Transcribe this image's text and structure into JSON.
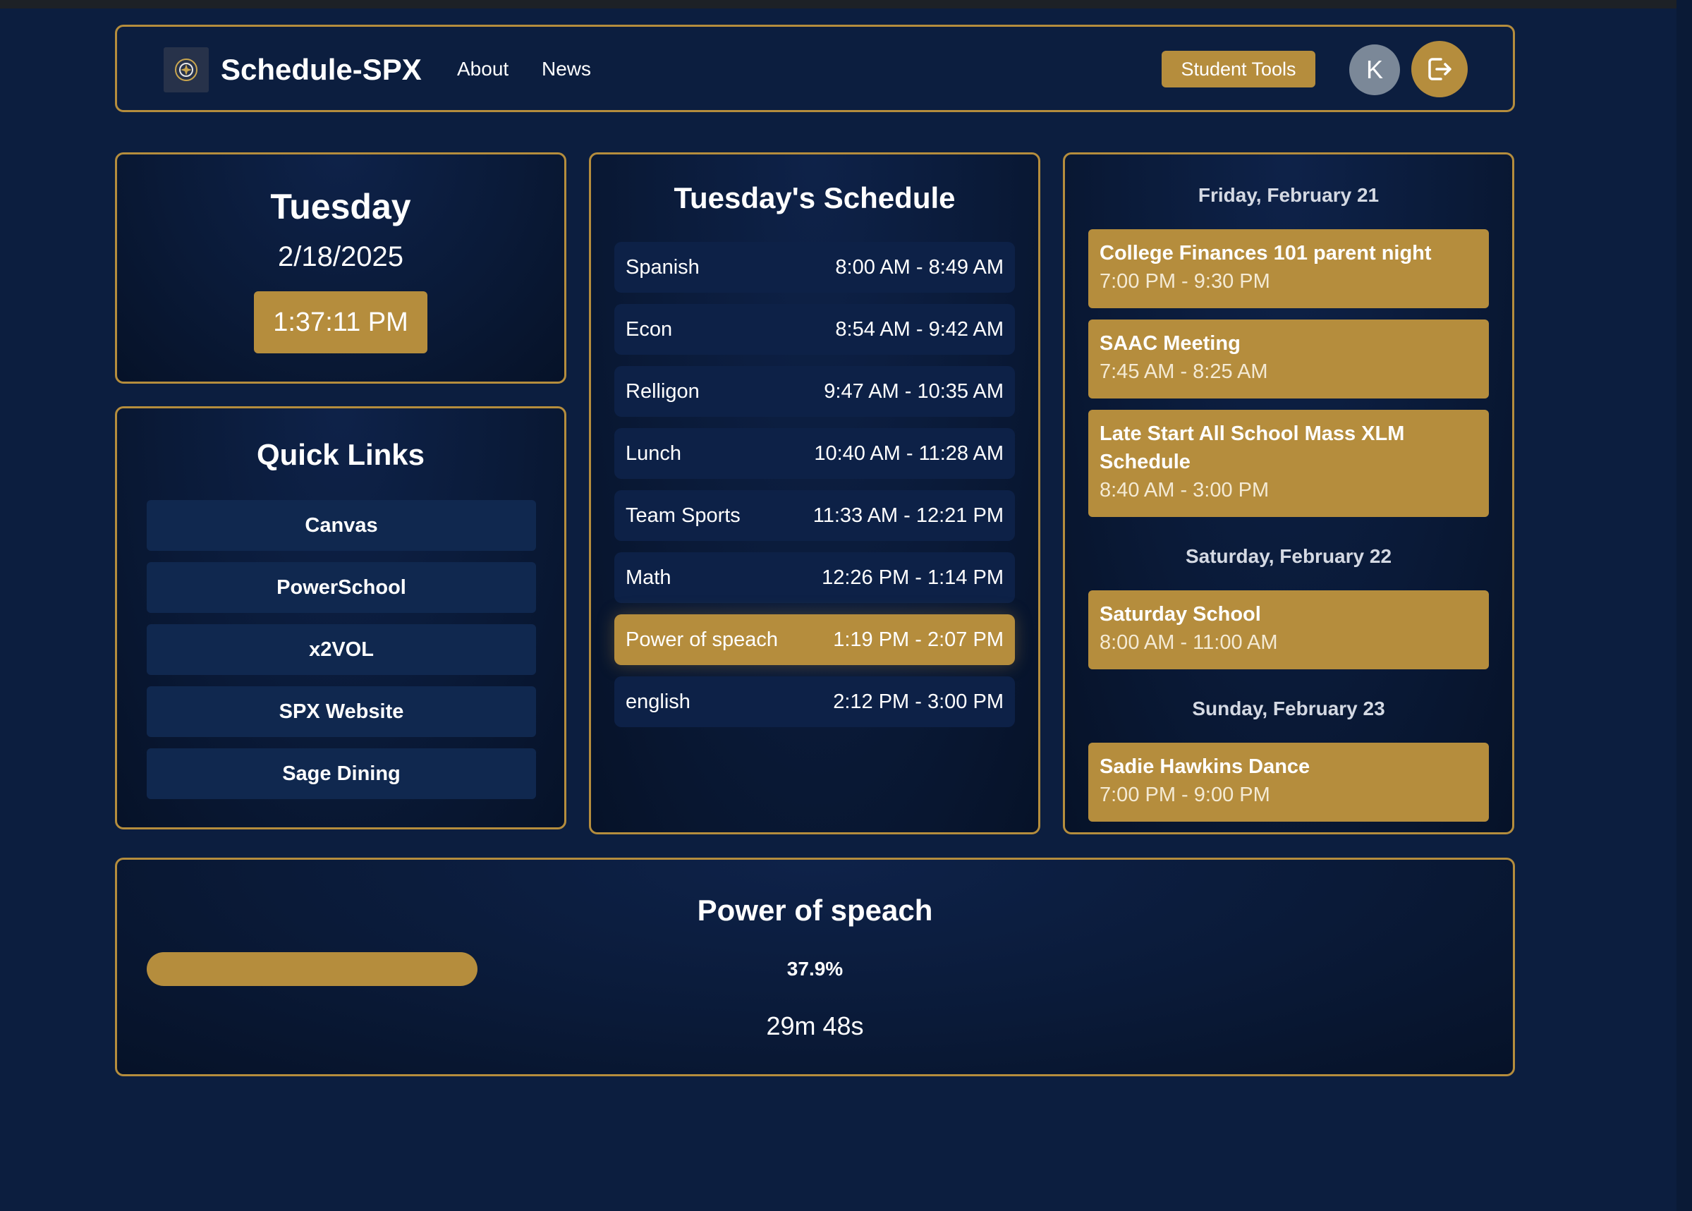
{
  "colors": {
    "background": "#0c1e3f",
    "accent": "#b58d3d",
    "card_border": "#b58d3d",
    "link_button": "#10284f",
    "avatar": "#7b8898"
  },
  "navbar": {
    "brand": "Schedule-SPX",
    "logo_icon": "school-crest-icon",
    "links": [
      "About",
      "News"
    ],
    "student_tools": "Student Tools",
    "avatar_initial": "K",
    "logout_icon": "logout-icon"
  },
  "today": {
    "day": "Tuesday",
    "date": "2/18/2025",
    "time": "1:37:11 PM"
  },
  "quick_links": {
    "title": "Quick Links",
    "items": [
      "Canvas",
      "PowerSchool",
      "x2VOL",
      "SPX Website",
      "Sage Dining"
    ]
  },
  "schedule": {
    "title": "Tuesday's Schedule",
    "periods": [
      {
        "name": "Spanish",
        "time": "8:00 AM - 8:49 AM",
        "current": false
      },
      {
        "name": "Econ",
        "time": "8:54 AM - 9:42 AM",
        "current": false
      },
      {
        "name": "Relligon",
        "time": "9:47 AM - 10:35 AM",
        "current": false
      },
      {
        "name": "Lunch",
        "time": "10:40 AM - 11:28 AM",
        "current": false
      },
      {
        "name": "Team Sports",
        "time": "11:33 AM - 12:21 PM",
        "current": false
      },
      {
        "name": "Math",
        "time": "12:26 PM - 1:14 PM",
        "current": false
      },
      {
        "name": "Power of speach",
        "time": "1:19 PM - 2:07 PM",
        "current": true
      },
      {
        "name": "english",
        "time": "2:12 PM - 3:00 PM",
        "current": false
      }
    ]
  },
  "events": {
    "days": [
      {
        "heading": "Friday, February 21",
        "items": [
          {
            "title": "College Finances 101 parent night",
            "time": "7:00 PM - 9:30 PM"
          },
          {
            "title": "SAAC Meeting",
            "time": "7:45 AM - 8:25 AM"
          },
          {
            "title": "Late Start All School Mass XLM Schedule",
            "time": "8:40 AM - 3:00 PM"
          }
        ]
      },
      {
        "heading": "Saturday, February 22",
        "items": [
          {
            "title": "Saturday School",
            "time": "8:00 AM - 11:00 AM"
          }
        ]
      },
      {
        "heading": "Sunday, February 23",
        "items": [
          {
            "title": "Sadie Hawkins Dance",
            "time": "7:00 PM - 9:00 PM"
          }
        ]
      }
    ]
  },
  "progress": {
    "title": "Power of speach",
    "percent_label": "37.9%",
    "percent": 37.9,
    "remaining": "29m 48s"
  }
}
